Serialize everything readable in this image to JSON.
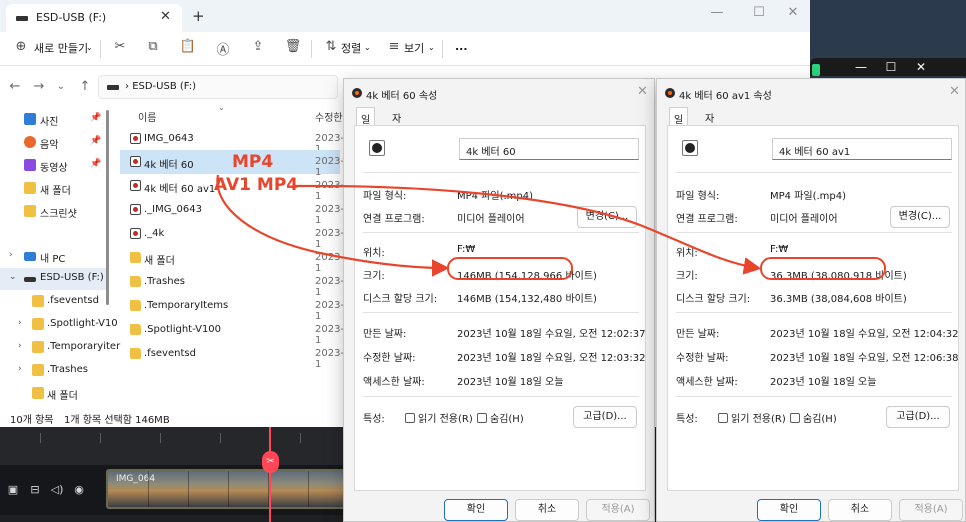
{
  "explorer": {
    "tab_label": "ESD-USB (F:)",
    "toolbar": {
      "new_label": "새로 만들기",
      "sort_label": "정렬",
      "view_label": "보기",
      "more_label": "..."
    },
    "address": "ESD-USB (F:)",
    "sidebar": {
      "items": [
        {
          "label": "사진"
        },
        {
          "label": "음악"
        },
        {
          "label": "동영상"
        },
        {
          "label": "새 폴더"
        },
        {
          "label": "스크린샷"
        },
        {
          "label": "내 PC"
        },
        {
          "label": "ESD-USB (F:)"
        },
        {
          "label": ".fseventsd"
        },
        {
          "label": ".Spotlight-V10"
        },
        {
          "label": ".Temporaryiter"
        },
        {
          "label": ".Trashes"
        },
        {
          "label": "새 폴더"
        }
      ]
    },
    "columns": {
      "name": "이름",
      "modified": "수정한"
    },
    "files": [
      {
        "name": "IMG_0643",
        "date": "2023-1"
      },
      {
        "name": "4k 베터 60",
        "date": "2023-1"
      },
      {
        "name": "4k 베터 60 av1",
        "date": "2023-1"
      },
      {
        "name": "._IMG_0643",
        "date": "2023-1"
      },
      {
        "name": "._4k",
        "date": "2023-1"
      },
      {
        "name": "새 폴더",
        "date": "2023-1"
      },
      {
        "name": ".Trashes",
        "date": "2023-1"
      },
      {
        "name": ".TemporaryItems",
        "date": "2023-1"
      },
      {
        "name": ".Spotlight-V100",
        "date": "2023-1"
      },
      {
        "name": ".fseventsd",
        "date": "2023-1"
      }
    ],
    "status": {
      "count": "10개 항목",
      "selected": "1개 항목 선택함 146MB"
    }
  },
  "editor": {
    "clip_label": "IMG_064"
  },
  "dialog1": {
    "title": "4k 베터 60 속성",
    "tabs": [
      "일반",
      "자세히"
    ],
    "file_name": "4k 베터 60",
    "rows": {
      "type_label": "파일 형식:",
      "type_value": "MP4 파일(.mp4)",
      "app_label": "연결 프로그램:",
      "app_value": "미디어 플레이어",
      "change_button": "변경(C)...",
      "loc_label": "위치:",
      "loc_value": "F:₩",
      "size_label": "크기:",
      "size_value": "146MB (154,128,966 바이트)",
      "disk_label": "디스크 할당 크기:",
      "disk_value": "146MB (154,132,480 바이트)",
      "created_label": "만든 날짜:",
      "created_value": "2023년 10월 18일 수요일, 오전 12:02:37",
      "modified_label": "수정한 날짜:",
      "modified_value": "2023년 10월 18일 수요일, 오전 12:03:32",
      "accessed_label": "액세스한 날짜:",
      "accessed_value": "2023년 10월 18일 오늘",
      "attr_label": "특성:",
      "readonly_label": "읽기 전용(R)",
      "hidden_label": "숨김(H)",
      "advanced_button": "고급(D)..."
    },
    "buttons": {
      "ok": "확인",
      "cancel": "취소",
      "apply": "적용(A)"
    }
  },
  "dialog2": {
    "title": "4k 베터 60 av1 속성",
    "tabs": [
      "일반",
      "자세히"
    ],
    "file_name": "4k 베터 60 av1",
    "rows": {
      "type_label": "파일 형식:",
      "type_value": "MP4 파일(.mp4)",
      "app_label": "연결 프로그램:",
      "app_value": "미디어 플레이어",
      "change_button": "변경(C)...",
      "loc_label": "위치:",
      "loc_value": "F:₩",
      "size_label": "크기:",
      "size_value": "36.3MB (38,080,918 바이트)",
      "disk_label": "디스크 할당 크기:",
      "disk_value": "36.3MB (38,084,608 바이트)",
      "created_label": "만든 날짜:",
      "created_value": "2023년 10월 18일 수요일, 오전 12:04:32",
      "modified_label": "수정한 날짜:",
      "modified_value": "2023년 10월 18일 수요일, 오전 12:06:38",
      "accessed_label": "액세스한 날짜:",
      "accessed_value": "2023년 10월 18일 오늘",
      "attr_label": "특성:",
      "readonly_label": "읽기 전용(R)",
      "hidden_label": "숨김(H)",
      "advanced_button": "고급(D)..."
    },
    "buttons": {
      "ok": "확인",
      "cancel": "취소",
      "apply": "적용(A)"
    }
  },
  "annotations": {
    "label_mp4": "MP4",
    "label_av1": "AV1 MP4",
    "color": "#e8452c"
  }
}
